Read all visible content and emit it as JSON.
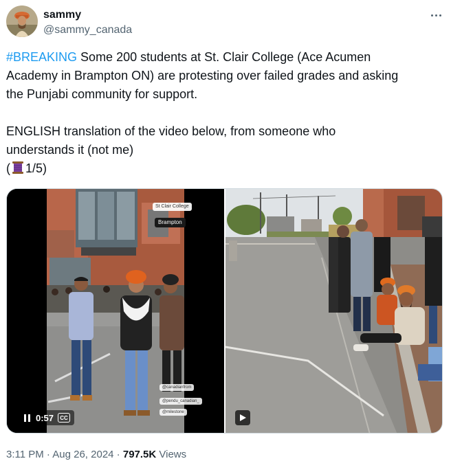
{
  "user": {
    "name": "sammy",
    "handle": "@sammy_canada"
  },
  "tweet": {
    "hashtag": "#BREAKING",
    "line1_rest": " Some 200 students at St. Clair College (Ace Acumen",
    "line2": "Academy in Brampton ON) are protesting over failed grades and asking",
    "line3": "the Punjabi community for support.",
    "line4": "ENGLISH translation of the video below, from someone who",
    "line5": "understands it (not me)",
    "thread_open": "(",
    "thread_count": "1/5)",
    "thread_icon": "spool-of-thread-icon"
  },
  "media": {
    "video1": {
      "duration": "0:57",
      "cc_label": "CC",
      "overlay_college": "St Clair College",
      "overlay_location": "Brampton",
      "overlay_handles": [
        "@canadianfrom",
        "@pendu_canadian_",
        "@milestone"
      ]
    },
    "video2": {}
  },
  "meta": {
    "time": "3:11 PM",
    "separator": " · ",
    "date": "Aug 26, 2024",
    "views_count": "797.5K",
    "views_label": " Views"
  },
  "colors": {
    "link": "#1d9bf0",
    "secondary_text": "#536471",
    "primary_text": "#0f1419",
    "border": "#cfd9de"
  }
}
